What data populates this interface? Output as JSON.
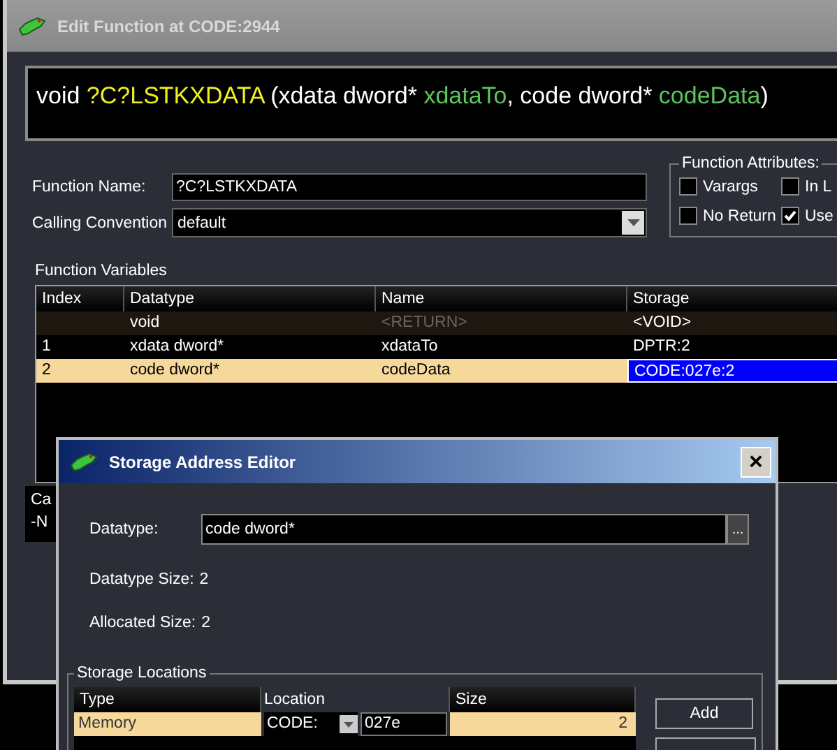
{
  "window": {
    "title": "Edit Function at CODE:2944"
  },
  "signature": [
    {
      "kind": "plain",
      "text": "void "
    },
    {
      "kind": "name",
      "text": "?C?LSTKXDATA"
    },
    {
      "kind": "plain",
      "text": " (xdata dword* "
    },
    {
      "kind": "param",
      "text": "xdataTo"
    },
    {
      "kind": "plain",
      "text": ", code dword* "
    },
    {
      "kind": "param",
      "text": "codeData"
    },
    {
      "kind": "plain",
      "text": ")"
    }
  ],
  "function_name": {
    "label": "Function Name:",
    "value": "?C?LSTKXDATA"
  },
  "calling_convention": {
    "label": "Calling Convention",
    "value": "default"
  },
  "attributes": {
    "title": "Function Attributes:",
    "items": [
      {
        "label": "Varargs",
        "checked": false
      },
      {
        "label": "In L",
        "checked": false
      },
      {
        "label": "No Return",
        "checked": false
      },
      {
        "label": "Use",
        "checked": true
      }
    ]
  },
  "variables": {
    "title": "Function Variables",
    "columns": [
      "Index",
      "Datatype",
      "Name",
      "Storage"
    ],
    "rows": [
      {
        "kind": "return",
        "index": "",
        "datatype": "void",
        "name": "<RETURN>",
        "storage": "<VOID>",
        "selected": false
      },
      {
        "kind": "param",
        "index": "1",
        "datatype": "xdata dword*",
        "name": "xdataTo",
        "storage": "DPTR:2",
        "selected": false
      },
      {
        "kind": "param",
        "index": "2",
        "datatype": "code dword*",
        "name": "codeData",
        "storage": "CODE:027e:2",
        "selected": true
      }
    ]
  },
  "hidden_box": [
    "Ca",
    "-N"
  ],
  "dialog": {
    "title": "Storage Address Editor",
    "close": "×",
    "datatype": {
      "label": "Datatype:",
      "value": "code dword*",
      "browse": "..."
    },
    "datatype_size": {
      "label": "Datatype Size:",
      "value": "2"
    },
    "allocated_size": {
      "label": "Allocated Size:",
      "value": "2"
    },
    "locations": {
      "title": "Storage Locations",
      "columns": [
        "Type",
        "Location",
        "Size"
      ],
      "rows": [
        {
          "type": "Memory",
          "space": "CODE:",
          "address": "027e",
          "size": "2",
          "selected": true
        }
      ]
    },
    "buttons": [
      "Add"
    ]
  }
}
